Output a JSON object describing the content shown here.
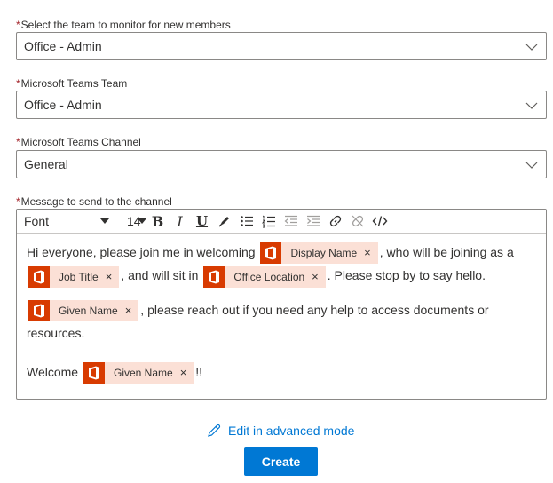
{
  "fields": [
    {
      "label": "Select the team to monitor for new members",
      "value": "Office - Admin"
    },
    {
      "label": "Microsoft Teams Team",
      "value": "Office - Admin"
    },
    {
      "label": "Microsoft Teams Channel",
      "value": "General"
    }
  ],
  "message": {
    "label": "Message to send to the channel",
    "toolbar": {
      "font": "Font",
      "size": "14",
      "bold": "B",
      "italic": "I",
      "underline": "U"
    },
    "p1": {
      "t1": "Hi everyone, please join me in welcoming",
      "token1": "Display Name",
      "t2": ", who will be joining as a",
      "token2": "Job Title",
      "t3": ", and will sit in",
      "token3": "Office Location",
      "t4": ". Please stop by to say hello."
    },
    "p2": {
      "token1": "Given Name",
      "t1": ", please reach out if you need any help to access documents or resources."
    },
    "p3": {
      "t1": "Welcome",
      "token1": "Given Name",
      "t2": "!!"
    },
    "token_remove": "×"
  },
  "advanced_link": "Edit in advanced mode",
  "create_button": "Create",
  "required_mark": "*",
  "colors": {
    "accent": "#0078d4",
    "office": "#d83b01",
    "token_bg": "#fbe0d6",
    "required": "#a4262c"
  }
}
